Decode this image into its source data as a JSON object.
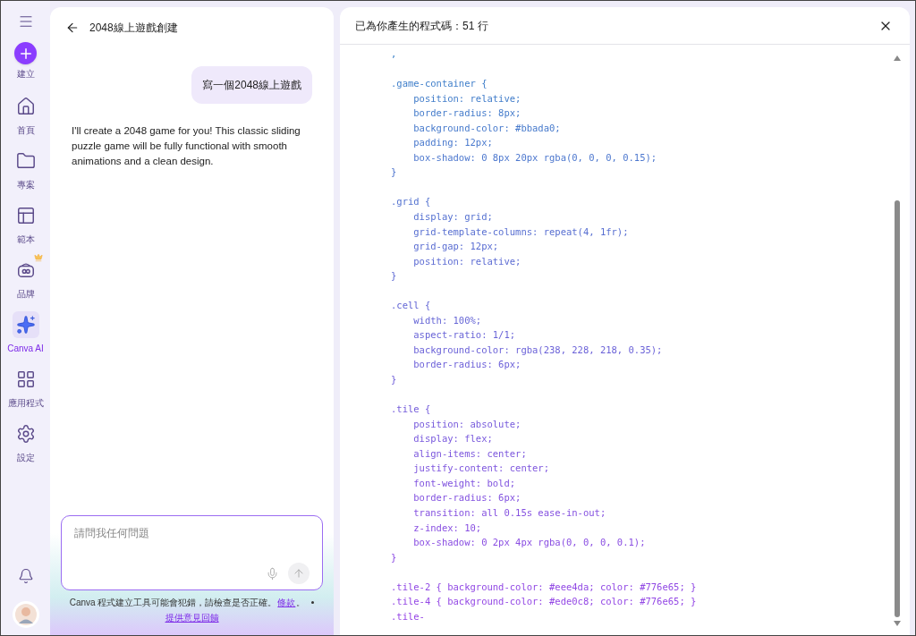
{
  "sidebar": {
    "items": [
      {
        "kind": "create",
        "label": "建立"
      },
      {
        "kind": "home",
        "label": "首頁",
        "selected": false
      },
      {
        "kind": "folder",
        "label": "專案",
        "selected": false
      },
      {
        "kind": "template",
        "label": "範本",
        "selected": false
      },
      {
        "kind": "brand",
        "label": "品牌",
        "selected": false,
        "crown": true
      },
      {
        "kind": "ai",
        "label": "Canva AI",
        "selected": true
      },
      {
        "kind": "apps",
        "label": "應用程式",
        "selected": false
      },
      {
        "kind": "settings",
        "label": "設定",
        "selected": false
      }
    ]
  },
  "chat": {
    "title": "2048線上遊戲創建",
    "messages": [
      {
        "kind": "user",
        "text": "寫一個2048線上遊戲"
      },
      {
        "kind": "assistant",
        "text": "I'll create a 2048 game for you! This classic sliding puzzle game will be fully functional with smooth animations and a clean design."
      }
    ],
    "input": {
      "placeholder": "請問我任何問題"
    },
    "disclaimer": "Canva 程式建立工具可能會犯錯，請檢查是否正確。",
    "terms_link": "條款",
    "terms_after": "。",
    "feedback_link": "提供意見回饋"
  },
  "code_panel": {
    "title": "已為你產生的程式碼：51 行",
    "code": ",\n\n.game-container {\n    position: relative;\n    border-radius: 8px;\n    background-color: #bbada0;\n    padding: 12px;\n    box-shadow: 0 8px 20px rgba(0, 0, 0, 0.15);\n}\n\n.grid {\n    display: grid;\n    grid-template-columns: repeat(4, 1fr);\n    grid-gap: 12px;\n    position: relative;\n}\n\n.cell {\n    width: 100%;\n    aspect-ratio: 1/1;\n    background-color: rgba(238, 228, 218, 0.35);\n    border-radius: 6px;\n}\n\n.tile {\n    position: absolute;\n    display: flex;\n    align-items: center;\n    justify-content: center;\n    font-weight: bold;\n    border-radius: 6px;\n    transition: all 0.15s ease-in-out;\n    z-index: 10;\n    box-shadow: 0 2px 4px rgba(0, 0, 0, 0.1);\n}\n\n.tile-2 { background-color: #eee4da; color: #776e65; }\n.tile-4 { background-color: #ede0c8; color: #776e65; }\n.tile-"
  }
}
